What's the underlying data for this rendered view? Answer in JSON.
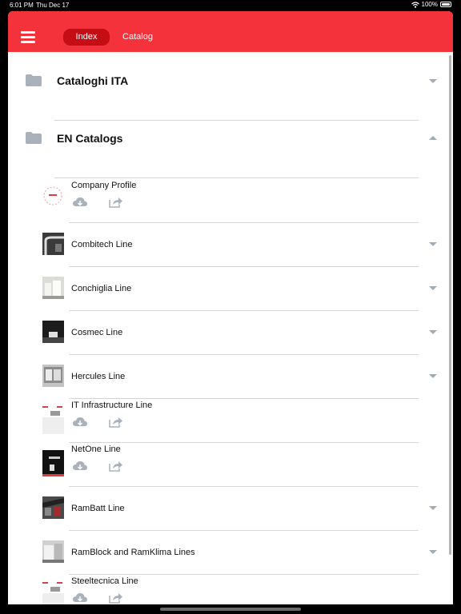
{
  "status": {
    "time": "6:01 PM",
    "day": "Thu Dec 17",
    "battery": "100%"
  },
  "header": {
    "tabs": [
      {
        "label": "Index",
        "active": true
      },
      {
        "label": "Catalog",
        "active": false
      }
    ]
  },
  "folders": [
    {
      "title": "Cataloghi ITA",
      "expanded": false
    },
    {
      "title": "EN Catalogs",
      "expanded": true
    }
  ],
  "items": [
    {
      "label": "Company Profile",
      "actions": true
    },
    {
      "label": "Combitech Line",
      "actions": false
    },
    {
      "label": "Conchiglia Line",
      "actions": false
    },
    {
      "label": "Cosmec Line",
      "actions": false
    },
    {
      "label": "Hercules Line",
      "actions": false
    },
    {
      "label": "IT Infrastructure Line",
      "actions": true
    },
    {
      "label": "NetOne Line",
      "actions": true
    },
    {
      "label": "RamBatt Line",
      "actions": false
    },
    {
      "label": "RamBlock and RamKlima Lines",
      "actions": false
    },
    {
      "label": "Steeltecnica Line",
      "actions": true
    }
  ],
  "colors": {
    "accent": "#f4323b",
    "active_tab": "#c40d15",
    "icon_gray": "#a2abb3"
  }
}
